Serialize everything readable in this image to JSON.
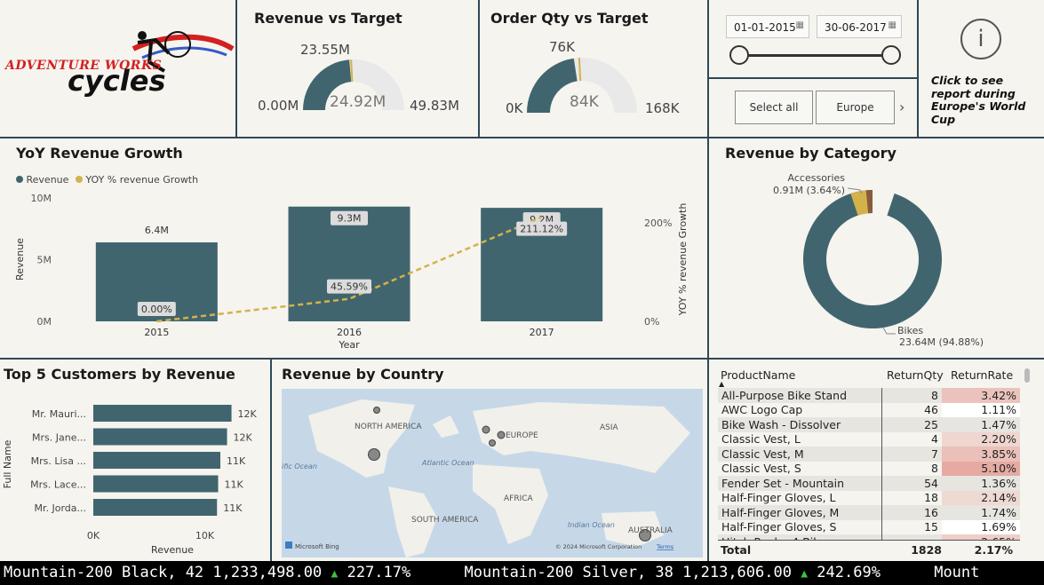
{
  "logo": {
    "line1": "ADVENTURE WORKS",
    "line2": "cycles"
  },
  "revenue_target": {
    "title": "Revenue vs Target",
    "current": "23.55M",
    "min": "0.00M",
    "center": "24.92M",
    "max": "49.83M",
    "fill_fraction": 0.4727,
    "target_fraction": 0.5
  },
  "order_target": {
    "title": "Order Qty vs Target",
    "current": "76K",
    "min": "0K",
    "center": "84K",
    "max": "168K",
    "fill_fraction": 0.4524,
    "target_fraction": 0.5
  },
  "date_filter": {
    "start": "01-01-2015",
    "end": "30-06-2017"
  },
  "region_filter": {
    "select_all": "Select all",
    "region": "Europe",
    "next_icon": "chevron-right-icon"
  },
  "info": {
    "icon": "info-icon",
    "glyph": "i",
    "text": "Click to see report during Europe's World Cup"
  },
  "yoy": {
    "title": "YoY Revenue Growth",
    "legend": [
      "Revenue",
      "YOY % revenue Growth"
    ]
  },
  "chart_data": [
    {
      "type": "bar",
      "title": "YoY Revenue Growth",
      "categories": [
        "2015",
        "2016",
        "2017"
      ],
      "series": [
        {
          "name": "Revenue",
          "values": [
            6.4,
            9.3,
            9.2
          ],
          "labels": [
            "6.4M",
            "9.3M",
            "9.2M"
          ]
        },
        {
          "name": "YOY % revenue Growth",
          "values": [
            0.0,
            45.59,
            211.12
          ],
          "labels": [
            "0.00%",
            "45.59%",
            "211.12%"
          ]
        }
      ],
      "xlabel": "Year",
      "ylabel": "Revenue",
      "y2label": "YOY % revenue Growth",
      "ylim": [
        0,
        10
      ],
      "y2lim": [
        0,
        250
      ],
      "yticks": [
        "0M",
        "5M",
        "10M"
      ],
      "y2ticks": [
        "0%",
        "200%"
      ],
      "colors": {
        "Revenue": "#41656f",
        "YOY % revenue Growth": "#d4b24a"
      }
    },
    {
      "type": "pie",
      "title": "Revenue by Category",
      "categories": [
        "Bikes",
        "Accessories",
        "Clothing"
      ],
      "values": [
        94.88,
        3.64,
        1.48
      ],
      "labels": [
        "Bikes",
        "Accessories",
        ""
      ],
      "value_labels": [
        "23.64M (94.88%)",
        "0.91M (3.64%)",
        ""
      ],
      "colors": [
        "#41656f",
        "#d4b24a",
        "#8a5a3c"
      ]
    },
    {
      "type": "bar",
      "title": "Top 5 Customers by Revenue",
      "categories": [
        "Mr. Mauri...",
        "Mrs. Jane...",
        "Mrs. Lisa ...",
        "Mrs. Lace...",
        "Mr. Jorda..."
      ],
      "values": [
        12.4,
        12.0,
        11.4,
        11.2,
        11.1
      ],
      "value_labels": [
        "12K",
        "12K",
        "11K",
        "11K",
        "11K"
      ],
      "xlabel": "Revenue",
      "ylabel": "Full Name",
      "xticks": [
        "0K",
        "10K"
      ],
      "xlim": [
        0,
        15
      ]
    }
  ],
  "map": {
    "title": "Revenue by Country",
    "labels": [
      "NORTH AMERICA",
      "EUROPE",
      "ASIA",
      "Atlantic Ocean",
      "AFRICA",
      "SOUTH AMERICA",
      "Indian Ocean",
      "AUSTRALIA",
      "ific Ocean"
    ],
    "credit": "Microsoft Bing",
    "copyright": "© 2024 Microsoft Corporation",
    "terms": "Terms"
  },
  "product_table": {
    "headers": [
      "ProductName",
      "ReturnQty",
      "ReturnRate"
    ],
    "rows": [
      [
        "All-Purpose Bike Stand",
        "8",
        "3.42%"
      ],
      [
        "AWC Logo Cap",
        "46",
        "1.11%"
      ],
      [
        "Bike Wash - Dissolver",
        "25",
        "1.47%"
      ],
      [
        "Classic Vest, L",
        "4",
        "2.20%"
      ],
      [
        "Classic Vest, M",
        "7",
        "3.85%"
      ],
      [
        "Classic Vest, S",
        "8",
        "5.10%"
      ],
      [
        "Fender Set - Mountain",
        "54",
        "1.36%"
      ],
      [
        "Half-Finger Gloves, L",
        "18",
        "2.14%"
      ],
      [
        "Half-Finger Gloves, M",
        "16",
        "1.74%"
      ],
      [
        "Half-Finger Gloves, S",
        "15",
        "1.69%"
      ],
      [
        "Hitch Rack - 4-Bike",
        "",
        "2.65%"
      ]
    ],
    "heat": [
      0.55,
      0,
      0,
      0.2,
      0.6,
      1.0,
      0,
      0.15,
      0,
      0,
      0.35
    ],
    "total": [
      "Total",
      "1828",
      "2.17%"
    ]
  },
  "ticker": {
    "items": [
      {
        "name": "Mountain-200 Black, 42",
        "value": "1,233,498.00",
        "arrow": "▲",
        "change": "227.17%"
      },
      {
        "name": "Mountain-200 Silver, 38",
        "value": "1,213,606.00",
        "arrow": "▲",
        "change": "242.69%"
      },
      {
        "name": "Mount",
        "value": "",
        "arrow": "",
        "change": ""
      }
    ]
  }
}
